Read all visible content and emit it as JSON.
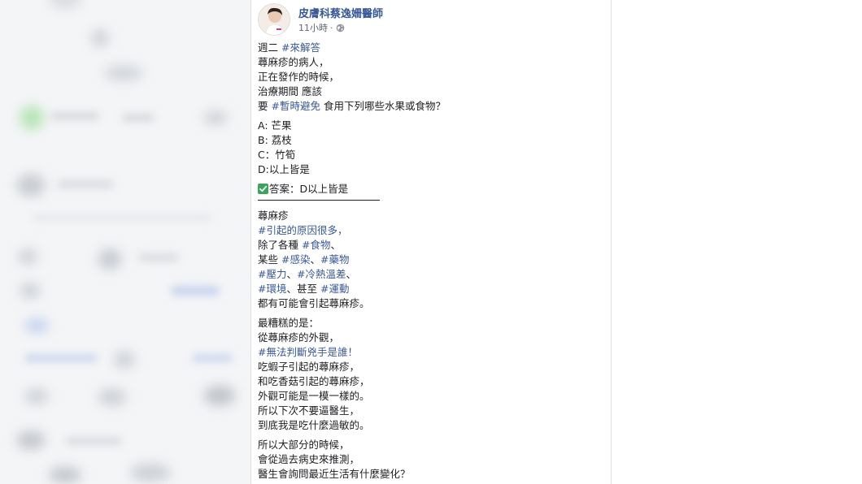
{
  "post": {
    "author": "皮膚科蔡逸姍醫師",
    "time": "11小時",
    "separator": "·",
    "intro": {
      "line1_prefix": "週二 ",
      "line1_tag": "#來解答",
      "line2": "蕁麻疹的病人，",
      "line3": "正在發作的時候，",
      "line4": "治療期間 應該",
      "line5_prefix": "要 ",
      "line5_tag": "#暫時避免",
      "line5_suffix": " 食用下列哪些水果或食物？"
    },
    "options": [
      "A: 芒果",
      "B: 荔枝",
      "C：竹筍",
      "D:以上皆是"
    ],
    "answer": "答案：D以上皆是",
    "section2": {
      "l1": "蕁麻疹",
      "l2_tag": "#引起的原因很多，",
      "l3_prefix": "除了各種 ",
      "l3_tag": "#食物",
      "l3_suffix": "、",
      "l4_prefix": "某些 ",
      "l4_tag1": "#感染",
      "l4_mid": "、",
      "l4_tag2": "#藥物",
      "l5_tag1": "#壓力",
      "l5_mid": "、",
      "l5_tag2": "#冷熱溫差",
      "l5_suffix": "、",
      "l6_tag1": "#環境",
      "l6_mid": "、甚至 ",
      "l6_tag2": "#運動",
      "l7": "都有可能會引起蕁麻疹。"
    },
    "section3": {
      "l1": "最糟糕的是：",
      "l2": "從蕁麻疹的外觀，",
      "l3_tag": "#無法判斷兇手是誰！",
      "l4": "吃蝦子引起的蕁麻疹，",
      "l5": "和吃香菇引起的蕁麻疹，",
      "l6": "外觀可能是一模一樣的。",
      "l7": "所以下次不要逼醫生，",
      "l8": "到底我是吃什麼過敏的。"
    },
    "section4": {
      "l1": "所以大部分的時候，",
      "l2": "會從過去病史來推測，",
      "l3": "醫生會詢問最近生活有什麼變化？"
    }
  },
  "icons": {
    "globe": "globe-icon",
    "check": "check-mark-icon",
    "avatar": "avatar"
  },
  "colors": {
    "link": "#385898",
    "text": "#1c1e21",
    "meta": "#616770",
    "check": "#3ba55c"
  }
}
